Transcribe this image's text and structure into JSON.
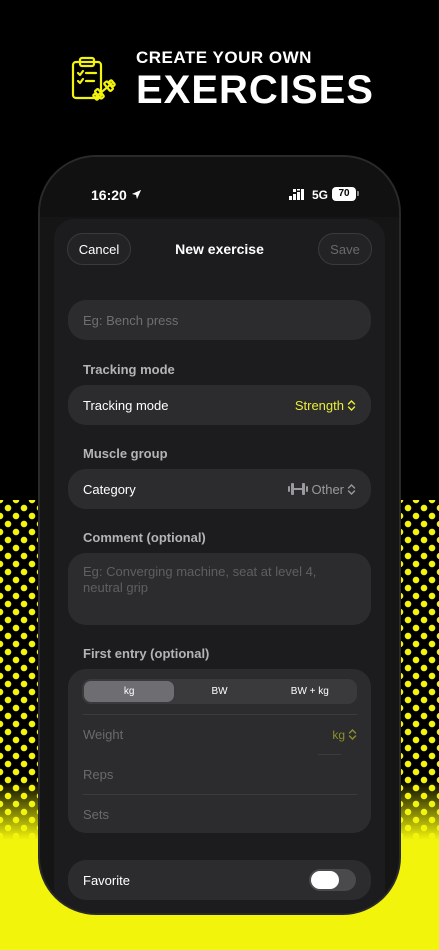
{
  "promo": {
    "small_title": "CREATE YOUR OWN",
    "big_title": "EXERCISES",
    "icon": "clipboard-dumbbell-icon",
    "accent": "#f2f50b"
  },
  "status": {
    "time": "16:20",
    "network": "5G",
    "battery": "70"
  },
  "nav": {
    "cancel": "Cancel",
    "title": "New exercise",
    "save": "Save"
  },
  "form": {
    "name_placeholder": "Eg: Bench press",
    "tracking": {
      "section": "Tracking mode",
      "label": "Tracking mode",
      "value": "Strength"
    },
    "muscle": {
      "section": "Muscle group",
      "label": "Category",
      "value": "Other"
    },
    "comment": {
      "section": "Comment (optional)",
      "placeholder": "Eg: Converging machine, seat at level 4, neutral grip"
    },
    "entry": {
      "section": "First entry (optional)",
      "segments": [
        "kg",
        "BW",
        "BW + kg"
      ],
      "selected_segment": "kg",
      "weight": "Weight",
      "weight_unit": "kg",
      "reps": "Reps",
      "sets": "Sets"
    },
    "favorite": {
      "label": "Favorite",
      "on": false
    }
  }
}
